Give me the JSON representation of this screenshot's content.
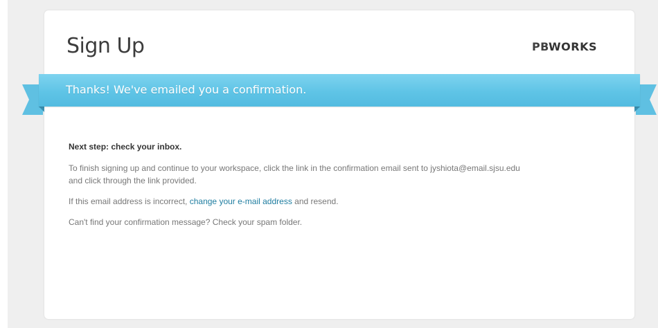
{
  "header": {
    "title": "Sign Up",
    "brand": {
      "prefix": "PB",
      "suffix": "WORKS"
    }
  },
  "banner": {
    "message": "Thanks! We've emailed you a confirmation."
  },
  "body": {
    "heading": "Next step: check your inbox.",
    "instructions_line1": "To finish signing up and continue to your workspace, click the link in the confirmation email sent to jyshiota@email.sjsu.edu",
    "instructions_line2": "and click through the link provided.",
    "incorrect_prefix": "If this email address is incorrect, ",
    "change_email_link": "change your e-mail address",
    "incorrect_suffix": " and resend.",
    "spam_note": "Can't find your confirmation message? Check your spam folder."
  },
  "colors": {
    "banner": "#5fc4e6",
    "link": "#1f7da0",
    "page_background": "#efefef"
  }
}
